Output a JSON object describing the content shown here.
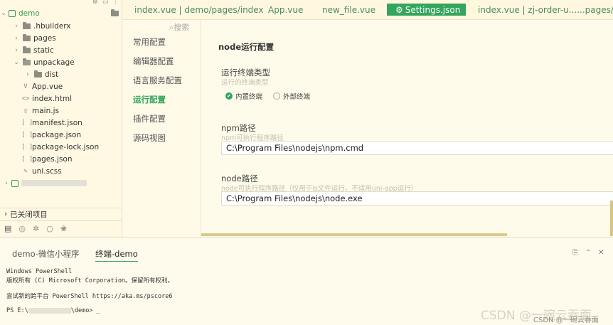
{
  "tree": {
    "project": "demo",
    "items": [
      {
        "label": ".hbuilderx",
        "kind": "folder"
      },
      {
        "label": "pages",
        "kind": "folder"
      },
      {
        "label": "static",
        "kind": "folder"
      },
      {
        "label": "unpackage",
        "kind": "folder-open"
      },
      {
        "label": "dist",
        "kind": "folder"
      },
      {
        "label": "App.vue",
        "kind": "vue"
      },
      {
        "label": "index.html",
        "kind": "html"
      },
      {
        "label": "main.js",
        "kind": "js"
      },
      {
        "label": "manifest.json",
        "kind": "json"
      },
      {
        "label": "package.json",
        "kind": "json"
      },
      {
        "label": "package-lock.json",
        "kind": "json"
      },
      {
        "label": "pages.json",
        "kind": "json"
      },
      {
        "label": "uni.scss",
        "kind": "scss"
      }
    ],
    "closed_projects": "已关闭项目"
  },
  "tabs": [
    "index.vue | demo/pages/index",
    "App.vue",
    "new_file.vue",
    "Settings.json",
    "index.vue | zj-order-u......pages/hc"
  ],
  "settings_nav": {
    "search": "搜索",
    "items": [
      "常用配置",
      "编辑器配置",
      "语言服务配置",
      "运行配置",
      "插件配置",
      "源码视图"
    ]
  },
  "panel": {
    "title": "node运行配置",
    "terminal_type_label": "运行终端类型",
    "terminal_type_desc": "运行的终端类型",
    "radio_builtin": "内置终端",
    "radio_external": "外部终端",
    "npm_label": "npm路径",
    "npm_desc": "npm可执行程序路径",
    "npm_value": "C:\\Program Files\\nodejs\\npm.cmd",
    "node_label": "node路径",
    "node_desc": "node可执行程序路径（仅用于js文件运行，不适用uni-app运行）",
    "node_value": "C:\\Program Files\\nodejs\\node.exe"
  },
  "terminal": {
    "tab1": "demo-微信小程序",
    "tab2": "终端-demo",
    "line1": "Windows PowerShell",
    "line2": "版权所有 (C) Microsoft Corporation。保留所有权利。",
    "line3": "尝试新的跨平台 PowerShell https://aka.ms/pscore6",
    "prompt_start": "PS E:\\",
    "prompt_end": "\\demo> _"
  },
  "watermark": "CSDN @一碗云吞面",
  "watermark_small": "CSDN @一碗云吞面"
}
